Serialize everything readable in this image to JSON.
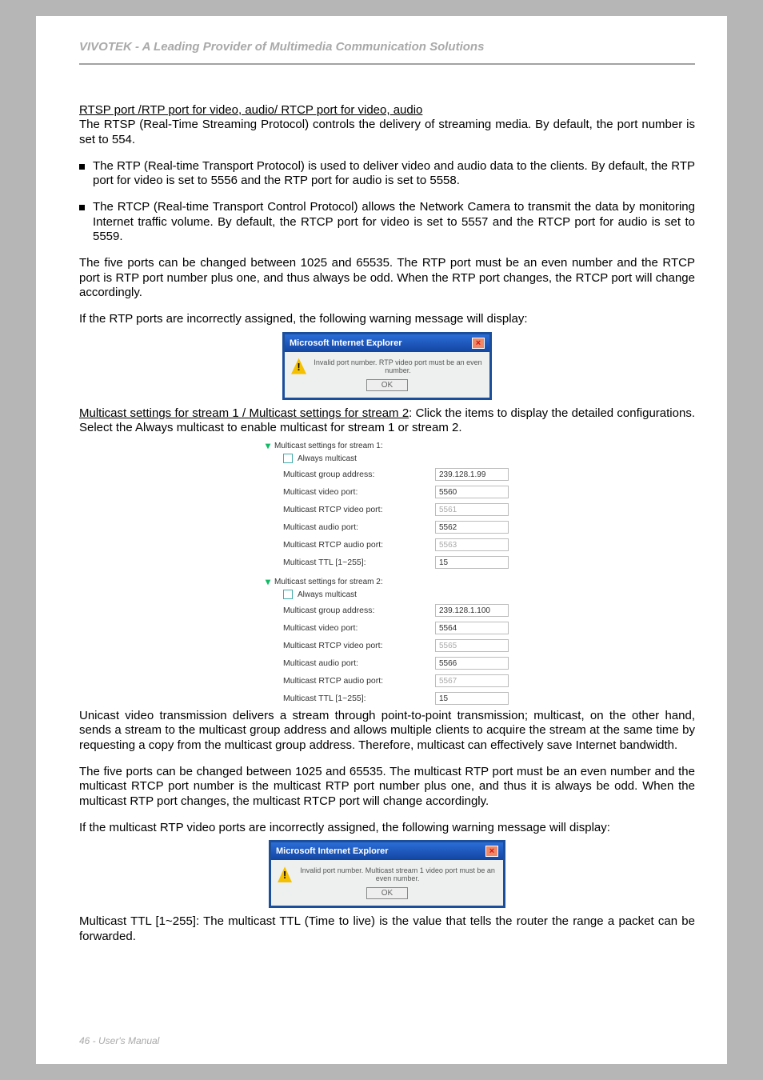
{
  "header": "VIVOTEK - A Leading Provider of Multimedia Communication Solutions",
  "sect1_title": "RTSP port /RTP port for video, audio/ RTCP port for video, audio",
  "p1": "The RTSP (Real-Time Streaming Protocol) controls the delivery of streaming media. By default, the port number is set to 554.",
  "b1": "The RTP (Real-time Transport Protocol) is used to deliver video and audio data to the clients. By default, the RTP port for video is set to 5556 and the RTP port for audio is set to 5558.",
  "b2": "The RTCP (Real-time Transport Control Protocol) allows the Network Camera to transmit the data by monitoring Internet traffic volume. By default, the RTCP port for video is set to 5557 and the RTCP port for audio is set to 5559.",
  "p2": "The five ports can be changed between 1025 and 65535. The RTP port must be an even number and the RTCP port is RTP port number plus one, and thus always be odd. When the RTP port changes, the RTCP port will change accordingly.",
  "p3": "If the RTP ports are incorrectly assigned, the following warning message will display:",
  "dlg1": {
    "title": "Microsoft Internet Explorer",
    "msg": "Invalid port number. RTP video port must be an even number.",
    "ok": "OK"
  },
  "sect2_u": "Multicast settings for stream 1 / Multicast settings for stream 2",
  "sect2_rest": ": Click the items to display the detailed configurations. Select the Always multicast to enable multicast for stream 1 or stream 2.",
  "mc": {
    "s1_title": "Multicast settings for stream 1:",
    "s2_title": "Multicast settings for stream 2:",
    "always": "Always multicast",
    "lbl_addr": "Multicast group address:",
    "lbl_vport": "Multicast video port:",
    "lbl_rtcp_v": "Multicast RTCP video port:",
    "lbl_aport": "Multicast audio port:",
    "lbl_rtcp_a": "Multicast RTCP audio port:",
    "lbl_ttl": "Multicast TTL [1~255]:",
    "s1": {
      "addr": "239.128.1.99",
      "vport": "5560",
      "rtcp_v": "5561",
      "aport": "5562",
      "rtcp_a": "5563",
      "ttl": "15"
    },
    "s2": {
      "addr": "239.128.1.100",
      "vport": "5564",
      "rtcp_v": "5565",
      "aport": "5566",
      "rtcp_a": "5567",
      "ttl": "15"
    }
  },
  "p4": "Unicast video transmission delivers a stream through point-to-point transmission; multicast, on the other hand, sends a stream to the multicast group address and allows multiple clients to acquire the stream at the same time by requesting a copy from the multicast group address. Therefore, multicast can effectively save Internet bandwidth.",
  "p5": "The five ports can be changed between 1025 and 65535. The multicast RTP port must be an even number and the multicast RTCP port number is the multicast RTP port number plus one, and thus it is always be odd. When the multicast RTP port changes, the multicast RTCP port will change accordingly.",
  "p6": "If the multicast RTP video ports are incorrectly assigned, the following warning message will display:",
  "dlg2": {
    "title": "Microsoft Internet Explorer",
    "msg": "Invalid port number. Multicast stream 1 video port must be an even number.",
    "ok": "OK"
  },
  "p7": "Multicast TTL [1~255]: The multicast TTL (Time to live) is the value that tells the router the range a packet can be forwarded.",
  "footer": "46 - User's Manual"
}
